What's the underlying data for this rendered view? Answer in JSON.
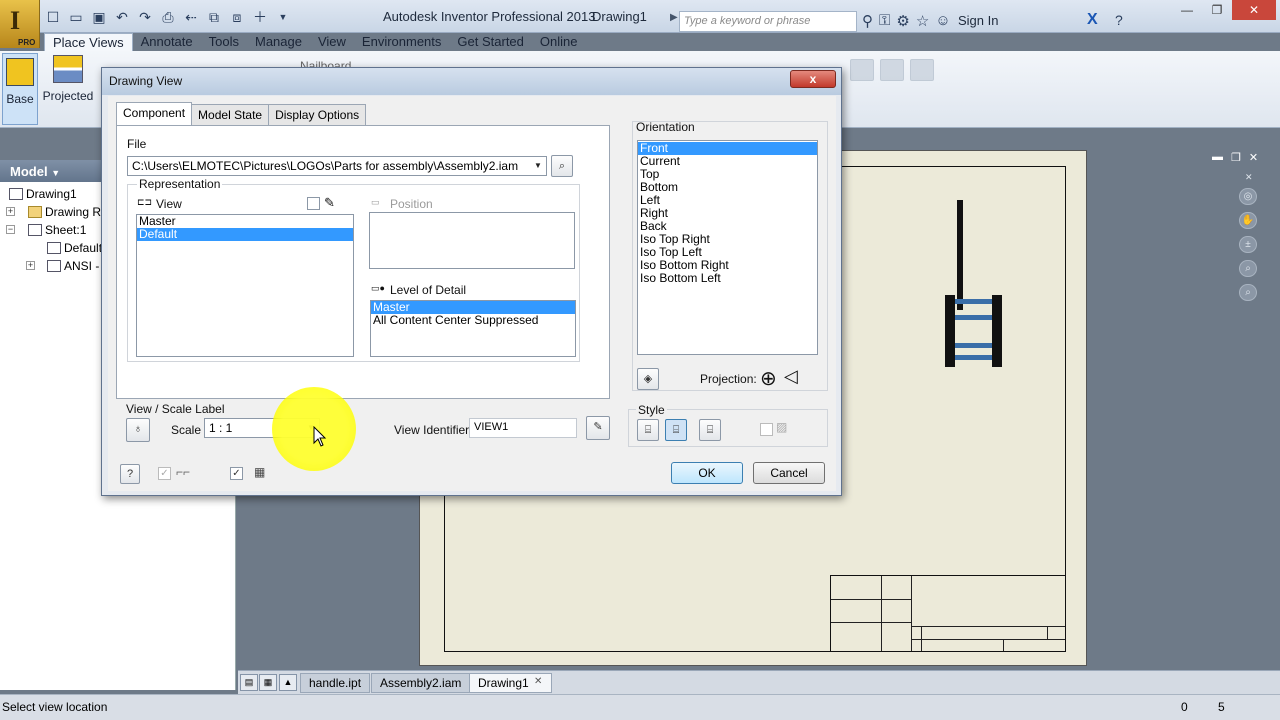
{
  "window": {
    "app_title": "Autodesk Inventor Professional 2013",
    "doc_title": "Drawing1",
    "search_placeholder": "Type a keyword or phrase",
    "sign_in": "Sign In",
    "logo_badge": "PRO"
  },
  "menu_tabs": [
    "Place Views",
    "Annotate",
    "Tools",
    "Manage",
    "View",
    "Environments",
    "Get Started",
    "Online"
  ],
  "ribbon": {
    "base_label": "Base",
    "projected_label": "Projected",
    "nailboard_label": "Nailboard"
  },
  "browser": {
    "header": "Model",
    "tree": [
      {
        "label": "Drawing1"
      },
      {
        "label": "Drawing Re"
      },
      {
        "label": "Sheet:1"
      },
      {
        "label": "Default"
      },
      {
        "label": "ANSI - L"
      }
    ]
  },
  "dialog": {
    "title": "Drawing View",
    "close_label": "x",
    "tabs": [
      "Component",
      "Model State",
      "Display Options"
    ],
    "file_label": "File",
    "file_path": "C:\\Users\\ELMOTEC\\Pictures\\LOGOs\\Parts for assembly\\Assembly2.iam",
    "representation_label": "Representation",
    "view_label": "View",
    "view_items": [
      "Master",
      "Default"
    ],
    "view_selected": 1,
    "position_label": "Position",
    "lod_label": "Level of Detail",
    "lod_items": [
      "Master",
      "All Content Center Suppressed"
    ],
    "lod_selected": 0,
    "view_scale_label": "View / Scale Label",
    "scale_label": "Scale",
    "scale_value": "1 : 1",
    "view_identifier_label": "View Identifier",
    "view_identifier_value": "VIEW1",
    "orientation_label": "Orientation",
    "orientations": [
      "Front",
      "Current",
      "Top",
      "Bottom",
      "Left",
      "Right",
      "Back",
      "Iso Top Right",
      "Iso Top Left",
      "Iso Bottom Right",
      "Iso Bottom Left"
    ],
    "orientation_selected": 0,
    "projection_label": "Projection:",
    "style_label": "Style",
    "ok_label": "OK",
    "cancel_label": "Cancel"
  },
  "doc_tabs": [
    "handle.ipt",
    "Assembly2.iam",
    "Drawing1"
  ],
  "active_doc_tab": 2,
  "status": {
    "text": "Select view location",
    "value1": "0",
    "value2": "5"
  },
  "colors": {
    "selection": "#3399ff",
    "sheet": "#ecead9",
    "highlight": "#ffff30"
  }
}
